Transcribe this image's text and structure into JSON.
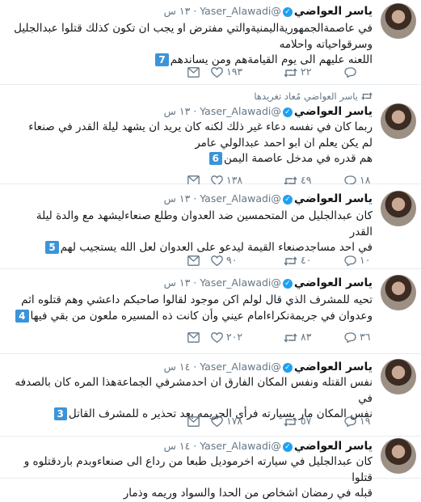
{
  "tweets": [
    {
      "name": "ياسر العواضي",
      "handle": "@Yaser_Alawadi",
      "time": "١٣ س",
      "retweeted": "",
      "lines": [
        "في عاصمةالجمهوريةاليمنيةوالتي مفترض او يجب ان تكون كذلك قتلوا عبدالجليل",
        "وسرقواحياته واحلامه",
        "اللعنه عليهم الى يوم القيامةهم ومن يساندهم"
      ],
      "badge": "7",
      "reply": "",
      "retweet": "٢٢",
      "like": "١٩٣"
    },
    {
      "name": "ياسر العواضي",
      "handle": "@Yaser_Alawadi",
      "time": "١٣ س",
      "retweeted": "ياسر العواضي مُعاد تغريدها",
      "lines": [
        "ربما كان في نفسه دعاء غير ذلك لكنه كان يريد ان يشهد ليلة القدر في صنعاء",
        "لم يكن يعلم ان ابو احمد عبدالولي عامر",
        "هم قدره في مدخل عاصمة اليمن"
      ],
      "badge": "6",
      "reply": "١٨",
      "retweet": "٤٩",
      "like": "١٣٨"
    },
    {
      "name": "ياسر العواضي",
      "handle": "@Yaser_Alawadi",
      "time": "١٣ س",
      "retweeted": "",
      "lines": [
        "كان عبدالجليل من المتحمسين ضد العدوان وطلع صنعاءليشهد مع والدة ليلة القدر",
        "في احد مساجدصنعاء القيمة  ليدعو على العدوان لعل الله يستجيب لهم"
      ],
      "badge": "5",
      "reply": "١٠",
      "retweet": "٤٠",
      "like": "٩٠"
    },
    {
      "name": "ياسر العواضي",
      "handle": "@Yaser_Alawadi",
      "time": "١٣ س",
      "retweeted": "",
      "lines": [
        "تحيه للمشرف الذي قال لولم اكن موجود لقالوا صاحبكم داعشي وهم قتلوه اثم",
        "وعدوان في جريمةنكراءامام عيني وأن   كانت ذه المسيره ملعون من بقي فيها"
      ],
      "badge": "4",
      "reply": "٣٦",
      "retweet": "٨٣",
      "like": "٢٠٢"
    },
    {
      "name": "ياسر العواضي",
      "handle": "@Yaser_Alawadi",
      "time": "١٤ س",
      "retweeted": "",
      "lines": [
        "نفس القتله ونفس المكان الفارق ان احدمشرفي الجماعةهذا المره كان بالصدفه في",
        "نفس المكان مار بسيارته فرأى الجريمه بعد تحذير ه للمشرف القاتل"
      ],
      "badge": "3",
      "reply": "١٩",
      "retweet": "٥٧",
      "like": "١٧٨"
    },
    {
      "name": "ياسر العواضي",
      "handle": "@Yaser_Alawadi",
      "time": "١٤ س",
      "retweeted": "",
      "lines": [
        "كان عبدالجليل في سيارته اخرموديل طبعا من رداع الى صنعاءوبدم باردقتلوه و قتلوا",
        "قبله في رمضان اشخاص من الحدا والسواد وريمه وذمار"
      ],
      "badge": "",
      "reply": "",
      "retweet": "",
      "like": ""
    }
  ]
}
